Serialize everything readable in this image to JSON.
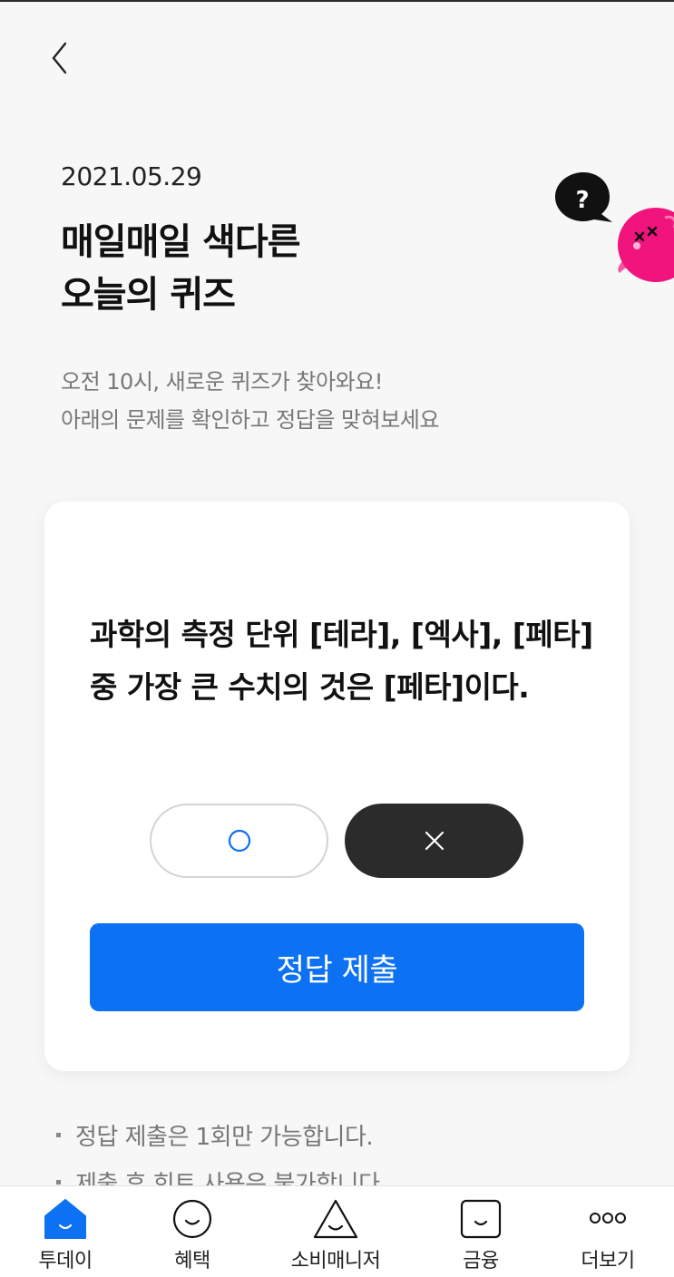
{
  "header": {
    "back_icon": "chevron-left-icon"
  },
  "quiz": {
    "date": "2021.05.29",
    "title_line1": "매일매일 색다른",
    "title_line2": "오늘의 퀴즈",
    "subtitle_line1": "오전 10시, 새로운 퀴즈가 찾아와요!",
    "subtitle_line2": "아래의 문제를 확인하고 정답을 맞혀보세요",
    "question": "과학의 측정 단위 [테라], [엑사], [페타] 중 가장 큰 수치의 것은 [페타]이다.",
    "selected_option": "X",
    "options": [
      {
        "icon": "circle-o-icon",
        "selected": false
      },
      {
        "icon": "close-x-icon",
        "selected": true
      }
    ],
    "submit_label": "정답 제출"
  },
  "notes": [
    "정답 제출은 1회만 가능합니다.",
    "제출 후 힌트 사용은 불가합니다"
  ],
  "tabbar": {
    "items": [
      {
        "label": "투데이",
        "icon": "home-icon",
        "active": true
      },
      {
        "label": "혜택",
        "icon": "smile-circle-icon",
        "active": false
      },
      {
        "label": "소비매니저",
        "icon": "triangle-face-icon",
        "active": false
      },
      {
        "label": "금융",
        "icon": "square-face-icon",
        "active": false
      },
      {
        "label": "더보기",
        "icon": "more-dots-icon",
        "active": false
      }
    ]
  },
  "colors": {
    "accent": "#0c71f3",
    "dark_button": "#2b2b2b",
    "mascot_pink": "#f0147c",
    "background": "#f7f7f8"
  }
}
